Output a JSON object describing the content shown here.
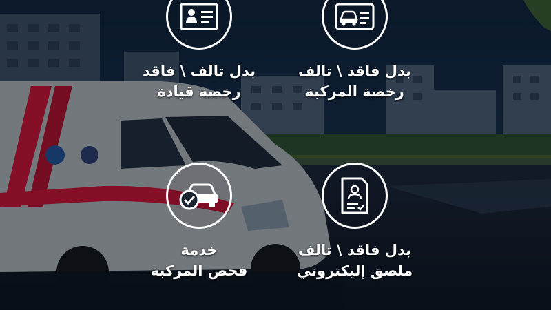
{
  "services": [
    {
      "id": "lost-driving-license",
      "title_line1": "بدل تالف \\ فاقد",
      "title_line2": "رخصة قيادة",
      "icon": "driver-license-icon"
    },
    {
      "id": "lost-vehicle-license",
      "title_line1": "بدل فاقد \\ تالف",
      "title_line2": "رخصة المركبة",
      "icon": "vehicle-license-icon"
    },
    {
      "id": "vehicle-inspection",
      "title_line1": "خدمة",
      "title_line2": "فحص المركبة",
      "icon": "car-check-icon"
    },
    {
      "id": "lost-electronic-sticker",
      "title_line1": "بدل فاقد \\ تالف",
      "title_line2": "ملصق إليكتروني",
      "icon": "sticker-document-icon"
    }
  ],
  "colors": {
    "text": "#ffffff",
    "accent": "#c8102e",
    "sky": "#0f2338"
  }
}
